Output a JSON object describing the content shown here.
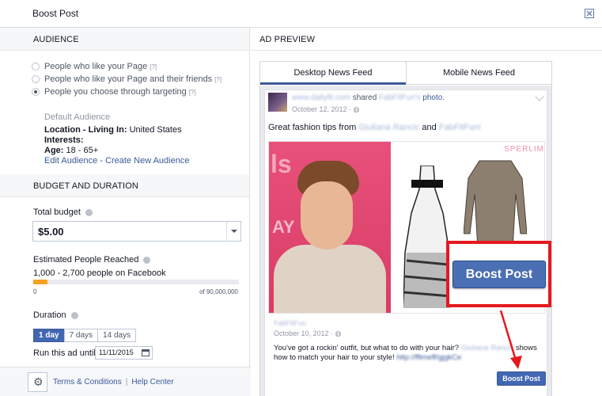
{
  "dialog": {
    "title": "Boost Post"
  },
  "audience": {
    "section_title": "AUDIENCE",
    "options": [
      {
        "label": "People who like your Page",
        "help": "[?]",
        "selected": false
      },
      {
        "label": "People who like your Page and their friends",
        "help": "[?]",
        "selected": false
      },
      {
        "label": "People you choose through targeting",
        "help": "[?]",
        "selected": true
      }
    ],
    "default_title": "Default Audience",
    "location_label": "Location - Living In:",
    "location_value": "United States",
    "interests_label": "Interests:",
    "age_label": "Age:",
    "age_value": "18 - 65+",
    "edit_link": "Edit Audience",
    "link_sep": " - ",
    "create_link": "Create New Audience"
  },
  "budget": {
    "section_title": "BUDGET AND DURATION",
    "total_label": "Total budget",
    "total_value": "$5.00",
    "reach_label": "Estimated People Reached",
    "reach_text": "1,000 - 2,700 people on Facebook",
    "reach_fraction": 0.07,
    "reach_min": "0",
    "reach_max": "of 90,000,000",
    "duration_label": "Duration",
    "durations": [
      "1 day",
      "7 days",
      "14 days"
    ],
    "duration_active": 0,
    "run_until_label": "Run this ad until",
    "run_until_value": "11/11/2015"
  },
  "footer": {
    "terms": "Terms & Conditions",
    "sep": "|",
    "help": "Help Center"
  },
  "preview": {
    "section_title": "AD PREVIEW",
    "tabs": [
      "Desktop News Feed",
      "Mobile News Feed"
    ],
    "active_tab": 0,
    "post": {
      "poster_name": "www.dailyfit.com",
      "shared_word": "shared",
      "shared_from": "FabFitFun's",
      "photo_word": "photo.",
      "date": "October 12, 2012 · ",
      "caption_prefix": "Great fashion tips from ",
      "caption_name1": "Giuliana Rancic",
      "caption_and": " and ",
      "caption_name2": "FabFitFun!",
      "photo_brand": "SPERLIM",
      "photo_side_text": "ls",
      "shared_name": "FabFitFun",
      "shared_date": "October 10, 2012 · ",
      "shared_text_1": "You've got a rockin' outfit, but what to do with your hair? ",
      "shared_text_blur": "Giuliana Rancic",
      "shared_text_2": " shows how to match your hair to your style! ",
      "shared_link": "http://fftmeff/gjgkCe"
    },
    "boost_button_small": "Boost Post",
    "boost_button_large": "Boost Post"
  },
  "colors": {
    "accent": "#3b5998",
    "button": "#4267b2",
    "highlight": "#e5191f",
    "slider_fill": "#f7a121"
  }
}
